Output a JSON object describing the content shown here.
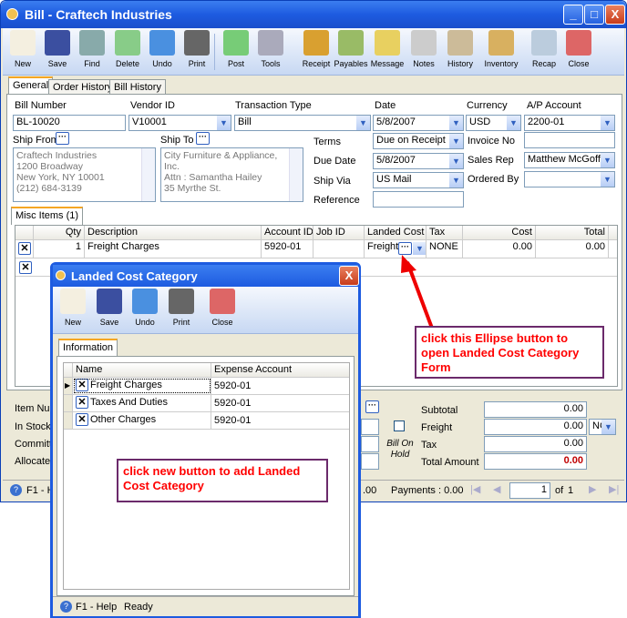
{
  "window": {
    "title": "Bill - Craftech Industries",
    "minimize": "_",
    "maximize": "□",
    "close": "X"
  },
  "toolbar": [
    {
      "label": "New",
      "icon": "new-icon"
    },
    {
      "label": "Save",
      "icon": "save-icon"
    },
    {
      "label": "Find",
      "icon": "binoculars-icon"
    },
    {
      "label": "Delete",
      "icon": "recycle-bin-icon"
    },
    {
      "label": "Undo",
      "icon": "undo-icon"
    },
    {
      "label": "Print",
      "icon": "printer-icon"
    },
    {
      "label": "Post",
      "icon": "post-icon"
    },
    {
      "label": "Tools",
      "icon": "tools-icon"
    },
    {
      "label": "Receipt",
      "icon": "receipt-icon"
    },
    {
      "label": "Payables",
      "icon": "payables-icon"
    },
    {
      "label": "Message",
      "icon": "message-icon"
    },
    {
      "label": "Notes",
      "icon": "notes-icon"
    },
    {
      "label": "History",
      "icon": "history-icon"
    },
    {
      "label": "Inventory",
      "icon": "inventory-icon"
    },
    {
      "label": "Recap",
      "icon": "recap-icon"
    },
    {
      "label": "Close",
      "icon": "close-icon"
    }
  ],
  "tabs": [
    "General",
    "Order History",
    "Bill History"
  ],
  "form": {
    "bill_number_label": "Bill Number",
    "bill_number": "BL-10020",
    "vendor_label": "Vendor ID",
    "vendor": "V10001",
    "type_label": "Transaction Type",
    "type": "Bill",
    "date_label": "Date",
    "date": "5/8/2007",
    "currency_label": "Currency",
    "currency": "USD",
    "ap_label": "A/P Account",
    "ap": "2200-01",
    "ship_from_label": "Ship From",
    "ship_from": [
      "Craftech Industries",
      "1200 Broadway",
      "New York, NY 10001",
      "(212) 684-3139"
    ],
    "ship_to_label": "Ship To",
    "ship_to": [
      "City Furniture & Appliance,",
      "Inc.",
      "Attn : Samantha Hailey",
      "35 Myrthe St."
    ],
    "terms_label": "Terms",
    "terms": "Due on Receipt",
    "due_label": "Due Date",
    "due": "5/8/2007",
    "shipvia_label": "Ship Via",
    "shipvia": "US Mail",
    "reference_label": "Reference",
    "reference": "",
    "invoice_label": "Invoice No",
    "invoice": "",
    "salesrep_label": "Sales Rep",
    "salesrep": "Matthew McGoff",
    "orderedby_label": "Ordered By",
    "orderedby": ""
  },
  "misc_tab": "Misc Items (1)",
  "grid": {
    "headers": [
      "Qty",
      "Description",
      "Account ID",
      "Job ID",
      "Landed Cost",
      "Tax",
      "Cost",
      "Total"
    ],
    "row": {
      "qty": "1",
      "description": "Freight Charges",
      "account": "5920-01",
      "job": "",
      "landed": "Freight",
      "tax": "NONE",
      "cost": "0.00",
      "total": "0.00"
    }
  },
  "bottom": {
    "item_num": "Item Num",
    "in_stock": "In Stock",
    "committed": "Committe",
    "allocated": "Allocated",
    "bill_on_hold": "Bill On Hold",
    "subtotal_label": "Subtotal",
    "subtotal": "0.00",
    "freight_label": "Freight",
    "freight": "0.00",
    "freight_code": "NC",
    "tax_label": "Tax",
    "tax": "0.00",
    "total_label": "Total Amount",
    "total": "0.00"
  },
  "status": {
    "help": "F1 - H",
    "amount": ".00",
    "payments": "Payments : 0.00",
    "page": "1",
    "of": "of",
    "pages": "1"
  },
  "dialog": {
    "title": "Landed Cost Category",
    "close": "X",
    "toolbar": [
      {
        "label": "New",
        "icon": "new-icon"
      },
      {
        "label": "Save",
        "icon": "save-icon"
      },
      {
        "label": "Undo",
        "icon": "undo-icon"
      },
      {
        "label": "Print",
        "icon": "printer-icon"
      },
      {
        "label": "Close",
        "icon": "close-icon"
      }
    ],
    "tab": "Information",
    "headers": [
      "Name",
      "Expense Account"
    ],
    "rows": [
      {
        "name": "Freight Charges",
        "account": "5920-01"
      },
      {
        "name": "Taxes And Duties",
        "account": "5920-01"
      },
      {
        "name": "Other Charges",
        "account": "5920-01"
      }
    ],
    "status_help": "F1 - Help",
    "status_ready": "Ready"
  },
  "notes": {
    "ellipse": "click this Ellipse button to open Landed Cost Category Form",
    "new": "click new button to add Landed Cost Category"
  },
  "colors": {
    "title_blue": "#1d5be0",
    "note_text": "#ff0000",
    "note_border": "#6b2a6b",
    "total_red": "#c00000"
  }
}
